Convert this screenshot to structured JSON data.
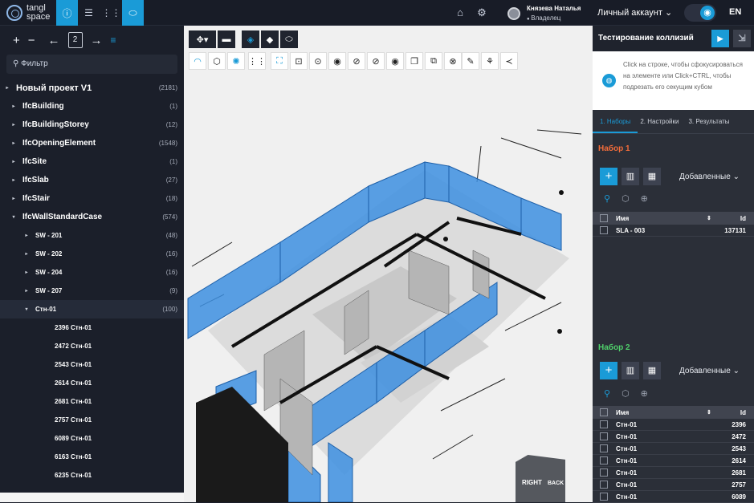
{
  "topbar": {
    "logo_line1": "tangl",
    "logo_line2": "space",
    "user_name": "Князева Наталья",
    "user_role": "Владелец",
    "account_label": "Личный аккаунт",
    "lang": "EN"
  },
  "left": {
    "page_number": "2",
    "filter_placeholder": "Фильтр",
    "tree": [
      {
        "label": "Новый проект V1",
        "count": "(2181)",
        "level": 0,
        "arrow": "▸"
      },
      {
        "label": "IfcBuilding",
        "count": "(1)",
        "level": 1,
        "arrow": "▸"
      },
      {
        "label": "IfcBuildingStorey",
        "count": "(12)",
        "level": 1,
        "arrow": "▸"
      },
      {
        "label": "IfcOpeningElement",
        "count": "(1548)",
        "level": 1,
        "arrow": "▸"
      },
      {
        "label": "IfcSite",
        "count": "(1)",
        "level": 1,
        "arrow": "▸"
      },
      {
        "label": "IfcSlab",
        "count": "(27)",
        "level": 1,
        "arrow": "▸"
      },
      {
        "label": "IfcStair",
        "count": "(18)",
        "level": 1,
        "arrow": "▸"
      },
      {
        "label": "IfcWallStandardCase",
        "count": "(574)",
        "level": 1,
        "arrow": "▾"
      },
      {
        "label": "SW - 201",
        "count": "(48)",
        "level": 2,
        "arrow": "▸"
      },
      {
        "label": "SW - 202",
        "count": "(16)",
        "level": 2,
        "arrow": "▸"
      },
      {
        "label": "SW - 204",
        "count": "(16)",
        "level": 2,
        "arrow": "▸"
      },
      {
        "label": "SW - 207",
        "count": "(9)",
        "level": 2,
        "arrow": "▸"
      },
      {
        "label": "Стн-01",
        "count": "(100)",
        "level": 2,
        "arrow": "▾"
      },
      {
        "label": "2396  Стн-01",
        "count": "",
        "level": 3,
        "arrow": ""
      },
      {
        "label": "2472  Стн-01",
        "count": "",
        "level": 3,
        "arrow": ""
      },
      {
        "label": "2543  Стн-01",
        "count": "",
        "level": 3,
        "arrow": ""
      },
      {
        "label": "2614  Стн-01",
        "count": "",
        "level": 3,
        "arrow": ""
      },
      {
        "label": "2681  Стн-01",
        "count": "",
        "level": 3,
        "arrow": ""
      },
      {
        "label": "2757  Стн-01",
        "count": "",
        "level": 3,
        "arrow": ""
      },
      {
        "label": "6089  Стн-01",
        "count": "",
        "level": 3,
        "arrow": ""
      },
      {
        "label": "6163  Стн-01",
        "count": "",
        "level": 3,
        "arrow": ""
      },
      {
        "label": "6235  Стн-01",
        "count": "",
        "level": 3,
        "arrow": ""
      }
    ]
  },
  "viewport": {
    "cube_right": "RIGHT",
    "cube_back": "BACK"
  },
  "right": {
    "title": "Тестирование коллизий",
    "hint": "Click на строке, чтобы сфокусироваться на элементе или Click+CTRL, чтобы подрезать его секущим кубом",
    "tabs": [
      "1. Наборы",
      "2. Настройки",
      "3. Результаты"
    ],
    "set1": {
      "title": "Набор 1",
      "color": "#f26c3a",
      "added_label": "Добавленные",
      "col_name": "Имя",
      "col_id": "Id",
      "rows": [
        {
          "name": "SLA - 003",
          "id": "137131"
        }
      ]
    },
    "set2": {
      "title": "Набор 2",
      "color": "#4fcf6a",
      "added_label": "Добавленные",
      "col_name": "Имя",
      "col_id": "Id",
      "rows": [
        {
          "name": "Стн-01",
          "id": "2396"
        },
        {
          "name": "Стн-01",
          "id": "2472"
        },
        {
          "name": "Стн-01",
          "id": "2543"
        },
        {
          "name": "Стн-01",
          "id": "2614"
        },
        {
          "name": "Стн-01",
          "id": "2681"
        },
        {
          "name": "Стн-01",
          "id": "2757"
        },
        {
          "name": "Стн-01",
          "id": "6089"
        }
      ]
    }
  },
  "colors": {
    "accent": "#1a9bd7",
    "wall_highlight": "#3d8fe0"
  }
}
